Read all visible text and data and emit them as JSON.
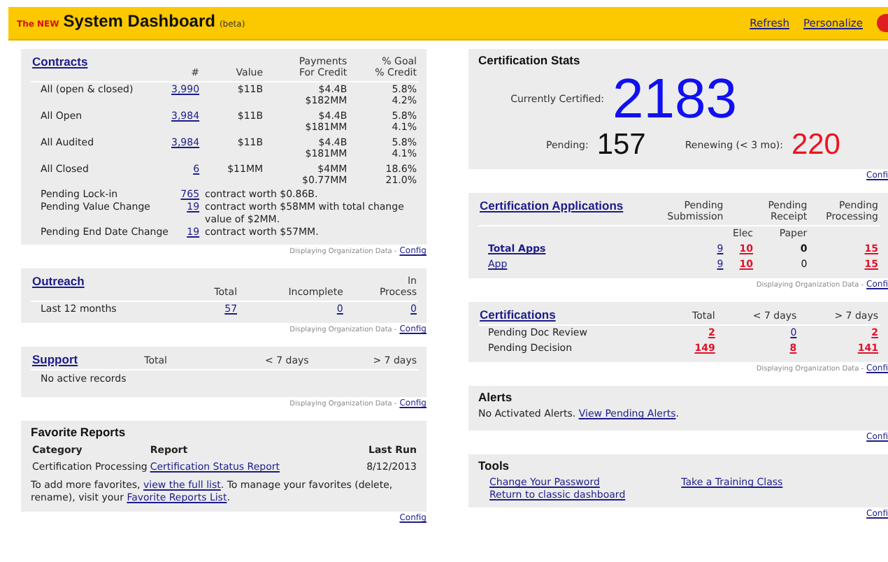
{
  "header": {
    "prefix": "The NEW",
    "title": "System Dashboard",
    "suffix": "(beta)",
    "links": [
      "Refresh",
      "Personalize"
    ]
  },
  "contracts": {
    "title": "Contracts",
    "columns": [
      "#",
      "Value",
      "Payments\nFor Credit",
      "% Goal\n% Credit"
    ],
    "rows": [
      {
        "label": "All (open & closed)",
        "count": "3,990",
        "value": "$11B",
        "payments": [
          "$4.4B",
          "$182MM"
        ],
        "goal": [
          "5.8%",
          "4.2%"
        ]
      },
      {
        "label": "All Open",
        "count": "3,984",
        "value": "$11B",
        "payments": [
          "$4.4B",
          "$181MM"
        ],
        "goal": [
          "5.8%",
          "4.1%"
        ]
      },
      {
        "label": "All Audited",
        "count": "3,984",
        "value": "$11B",
        "payments": [
          "$4.4B",
          "$181MM"
        ],
        "goal": [
          "5.8%",
          "4.1%"
        ]
      },
      {
        "label": "All Closed",
        "count": "6",
        "value": "$11MM",
        "payments": [
          "$4MM",
          "$0.77MM"
        ],
        "goal": [
          "18.6%",
          "21.0%"
        ]
      }
    ],
    "pending": [
      {
        "label": "Pending Lock-in",
        "count": "765",
        "text": "contract worth $0.86B."
      },
      {
        "label": "Pending Value Change",
        "count": "19",
        "text": "contract worth $58MM with total change value of $2MM."
      },
      {
        "label": "Pending End Date Change",
        "count": "19",
        "text": "contract worth $57MM."
      }
    ],
    "footer": {
      "text": "Displaying Organization Data -",
      "link": "Config"
    }
  },
  "outreach": {
    "title": "Outreach",
    "columns": [
      "Total",
      "Incomplete",
      "In\nProcess"
    ],
    "rows": [
      {
        "label": "Last 12 months",
        "cells": [
          "57",
          "0",
          "0"
        ]
      }
    ],
    "footer": {
      "text": "Displaying Organization Data -",
      "link": "Config"
    }
  },
  "support": {
    "title": "Support",
    "columns": [
      "Total",
      "< 7 days",
      "> 7 days"
    ],
    "note": "No active records",
    "footer": {
      "text": "Displaying Organization Data -",
      "link": "Config"
    }
  },
  "favorite_reports": {
    "title": "Favorite Reports",
    "columns": [
      "Category",
      "Report",
      "Last Run"
    ],
    "rows": [
      {
        "category": "Certification Processing",
        "report": "Certification Status Report",
        "last_run": "8/12/2013"
      }
    ],
    "note": [
      {
        "kind": "text",
        "text": "To add more favorites, "
      },
      {
        "kind": "link",
        "text": "view the full list"
      },
      {
        "kind": "text",
        "text": ". To manage your favorites (delete, rename), visit your "
      },
      {
        "kind": "link",
        "text": "Favorite Reports List"
      },
      {
        "kind": "text",
        "text": "."
      }
    ],
    "footer": {
      "link": "Config"
    }
  },
  "certification_stats": {
    "title": "Certification Stats",
    "items": [
      {
        "label": "Currently Certified:",
        "value": "2183",
        "color": "#1010f0"
      },
      {
        "label": "Pending:",
        "value": "157",
        "color": "#111111"
      },
      {
        "label": "Renewing (< 3 mo):",
        "value": "220",
        "color": "#ee1122"
      }
    ],
    "footer": {
      "link": "Confi"
    }
  },
  "certification_applications": {
    "title": "Certification Applications",
    "columns": [
      {
        "label": "Pending\nSubmission"
      },
      {
        "sublabel": "Elec"
      },
      {
        "label": "Pending\nReceipt",
        "sublabel": "Paper"
      },
      {
        "label": "Pending\nProcessing"
      }
    ],
    "rows": [
      {
        "label": "Total Apps",
        "kind": "total",
        "cells": [
          {
            "text": "9",
            "kind": "link"
          },
          {
            "text": "10",
            "kind": "alert"
          },
          {
            "text": "0",
            "kind": "plain"
          },
          {
            "text": "15",
            "kind": "alert"
          }
        ]
      },
      {
        "label": "App",
        "kind": "item",
        "cells": [
          {
            "text": "9",
            "kind": "link"
          },
          {
            "text": "10",
            "kind": "alert"
          },
          {
            "text": "0",
            "kind": "plain"
          },
          {
            "text": "15",
            "kind": "alert"
          }
        ]
      }
    ],
    "footer": {
      "text": "Displaying Organization Data -",
      "link": "Confi"
    }
  },
  "certifications": {
    "title": "Certifications",
    "columns": [
      "Total",
      "< 7 days",
      "> 7 days"
    ],
    "rows": [
      {
        "label": "Pending Doc Review",
        "cells": [
          {
            "text": "2",
            "kind": "alert"
          },
          {
            "text": "0",
            "kind": "link"
          },
          {
            "text": "2",
            "kind": "alert"
          }
        ]
      },
      {
        "label": "Pending Decision",
        "cells": [
          {
            "text": "149",
            "kind": "alert"
          },
          {
            "text": "8",
            "kind": "alert"
          },
          {
            "text": "141",
            "kind": "alert"
          }
        ]
      }
    ],
    "footer": {
      "text": "Displaying Organization Data -",
      "link": "Confi"
    }
  },
  "alerts": {
    "title": "Alerts",
    "note": [
      {
        "kind": "text",
        "text": "No Activated Alerts. "
      },
      {
        "kind": "link",
        "text": "View Pending Alerts"
      },
      {
        "kind": "text",
        "text": "."
      }
    ],
    "footer": {
      "link": "Confi"
    }
  },
  "tools": {
    "title": "Tools",
    "columns": [
      [
        "Change Your Password",
        "Return to classic dashboard"
      ],
      [
        "Take a Training Class"
      ]
    ],
    "footer": {
      "link": "Confi"
    }
  }
}
